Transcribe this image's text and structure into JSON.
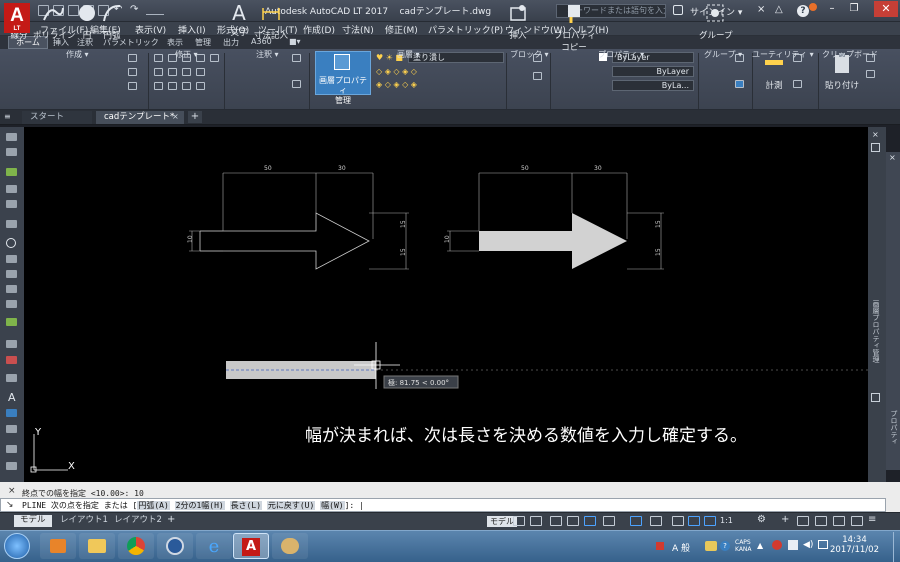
{
  "titlebar": {
    "app_title": "Autodesk AutoCAD LT 2017",
    "file_name": "cadテンプレート.dwg",
    "search_placeholder": "キーワードまたは語句を入力",
    "signin": "サインイン",
    "logo_sub": "LT"
  },
  "menubar": [
    "ファイル(F)",
    "編集(E)",
    "表示(V)",
    "挿入(I)",
    "形式(O)",
    "ツール(T)",
    "作成(D)",
    "寸法(N)",
    "修正(M)",
    "パラメトリック(P)",
    "ウィンドウ(W)",
    "ヘルプ(H)"
  ],
  "ribbon_tabs": [
    "ホーム",
    "挿入",
    "注釈",
    "パラメトリック",
    "表示",
    "管理",
    "出力",
    "A360"
  ],
  "ribbon": {
    "draw": {
      "line": "線分",
      "polyline": "ポリライン",
      "circle": "円",
      "arc": "円弧",
      "title": "作成"
    },
    "modify": {
      "title": "修正"
    },
    "annotation": {
      "text": "文字",
      "dimension": "寸法記入",
      "title": "注釈"
    },
    "layer_props": {
      "label1": "画層プロパティ",
      "label2": "管理",
      "title": "画層",
      "layer_name": "塗り潰し"
    },
    "block": {
      "insert": "挿入",
      "title": "ブロック"
    },
    "properties": {
      "match1": "プロパティ",
      "match2": "コピー",
      "bylayer1": "ByLayer",
      "bylayer2": "ByLayer",
      "bylayer3": "ByLa...",
      "title": "プロパティ"
    },
    "groups": {
      "label": "グループ",
      "title": "グループ"
    },
    "utilities": {
      "measure": "計測",
      "title": "ユーティリティ"
    },
    "clipboard": {
      "paste": "貼り付け",
      "title": "クリップボード"
    }
  },
  "file_tabs": [
    "スタート",
    "cadテンプレート*"
  ],
  "drawing": {
    "dims_left": {
      "top_a": "50",
      "top_b": "30",
      "left_h": "10",
      "right_a": "15",
      "right_b": "15"
    },
    "dims_right": {
      "top_a": "50",
      "top_b": "30",
      "left_h": "10",
      "right_a": "15",
      "right_b": "15"
    },
    "tooltip": "極: 81.75 < 0.00°",
    "caption": "幅が決まれば、次は長さを決める数値を入力し確定する。",
    "ucs_x": "X",
    "ucs_y": "Y"
  },
  "palette_right": "画層プロパティ管理",
  "palette_right2": "プロパティ",
  "command": {
    "history": "終点での幅を指定 <10.00>: 10",
    "prompt": "PLINE 次の点を指定 または",
    "options": [
      "円弧(A)",
      "2分の1幅(H)",
      "長さ(L)",
      "元に戻す(U)",
      "幅(W)"
    ],
    "suffix": "]:"
  },
  "layout_tabs": [
    "モデル",
    "レイアウト1",
    "レイアウト2"
  ],
  "status": {
    "model": "モデル",
    "scale": "1:1"
  },
  "taskbar": {
    "ime": "A 般",
    "time": "14:34",
    "date": "2017/11/02"
  }
}
